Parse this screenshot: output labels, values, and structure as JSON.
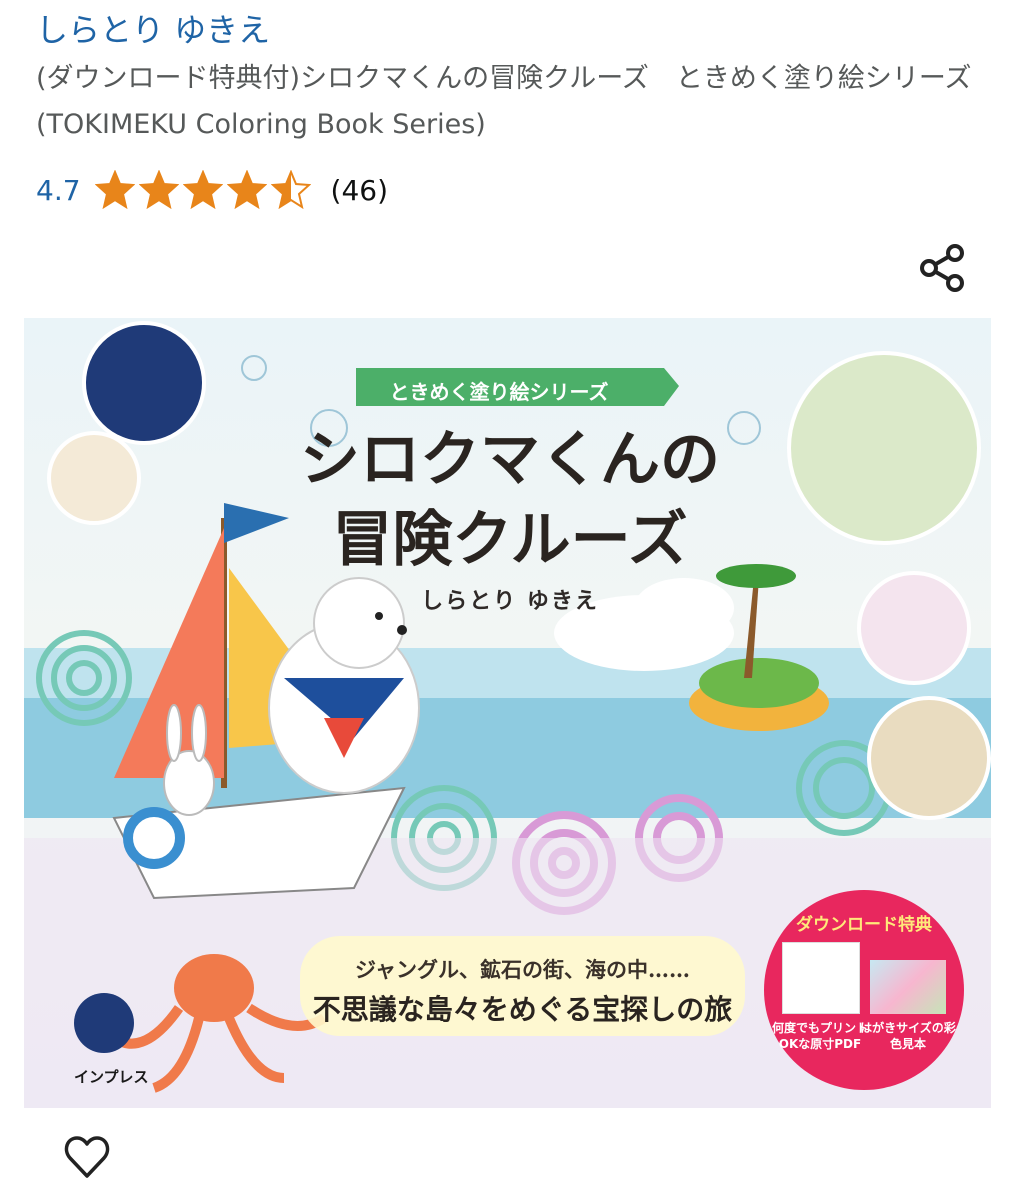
{
  "product": {
    "author": "しらとり ゆきえ",
    "title": "(ダウンロード特典付)シロクマくんの冒険クルーズ　ときめく塗り絵シリーズ(TOKIMEKU Coloring Book Series)",
    "rating_value": "4.7",
    "rating_stars": 4.5,
    "review_count": "(46)"
  },
  "icons": {
    "share": "share-icon",
    "wishlist": "heart-icon",
    "star": "star-icon"
  },
  "cover": {
    "series_banner": "ときめく塗り絵シリーズ",
    "title_line1": "シロクマくんの",
    "title_line2": "冒険クルーズ",
    "author": "しらとり ゆきえ",
    "tagline_line1": "ジャングル、鉱石の街、海の中……",
    "tagline_line2": "不思議な島々をめぐる宝探しの旅",
    "download_bonus_title": "ダウンロード特典",
    "download_caption1": "何度でもプリントOKな原寸PDF",
    "download_caption2": "はがきサイズの彩色見本",
    "publisher": "インプレス"
  },
  "colors": {
    "link": "#1f64a6",
    "star": "#e8851a",
    "title_gray": "#565959",
    "bonus_pink": "#e8275e"
  }
}
